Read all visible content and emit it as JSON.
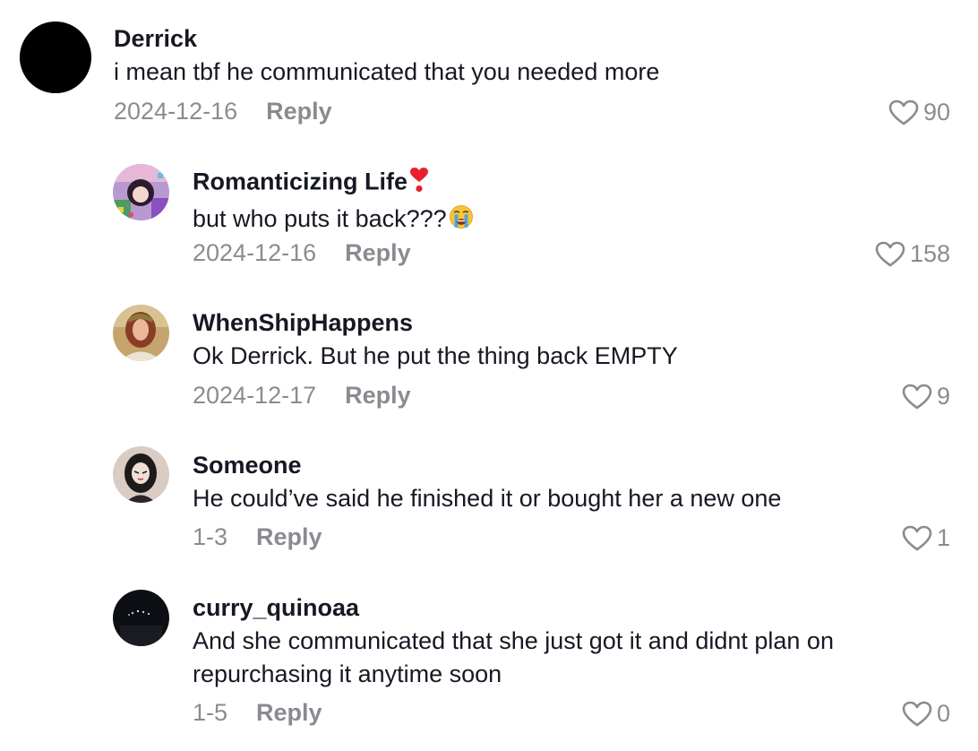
{
  "comments": [
    {
      "username": "Derrick",
      "text": "i mean tbf he communicated that you needed more",
      "date": "2024-12-16",
      "reply_label": "Reply",
      "likes": "90",
      "avatar_icon": "default-avatar-icon"
    },
    {
      "username": "Romanticizing Life",
      "username_emoji": "heart-exclamation-emoji-icon",
      "text": "but who puts it back???",
      "text_emoji": "crying-face-emoji-icon",
      "date": "2024-12-16",
      "reply_label": "Reply",
      "likes": "158",
      "avatar_icon": "user-photo-icon"
    },
    {
      "username": "WhenShipHappens",
      "text": "Ok Derrick. But he put the thing back EMPTY",
      "date": "2024-12-17",
      "reply_label": "Reply",
      "likes": "9",
      "avatar_icon": "user-photo-icon"
    },
    {
      "username": "Someone",
      "text": "He could’ve said he finished it or bought her a new one",
      "date": "1-3",
      "reply_label": "Reply",
      "likes": "1",
      "avatar_icon": "user-photo-icon"
    },
    {
      "username": "curry_quinoaa",
      "text": "And she communicated that she just got it and didnt plan on repurchasing it anytime soon",
      "date": "1-5",
      "reply_label": "Reply",
      "likes": "0",
      "avatar_icon": "user-photo-icon"
    }
  ],
  "colors": {
    "text_primary": "#161823",
    "text_secondary": "rgba(22,24,35,0.5)",
    "background": "#ffffff"
  }
}
